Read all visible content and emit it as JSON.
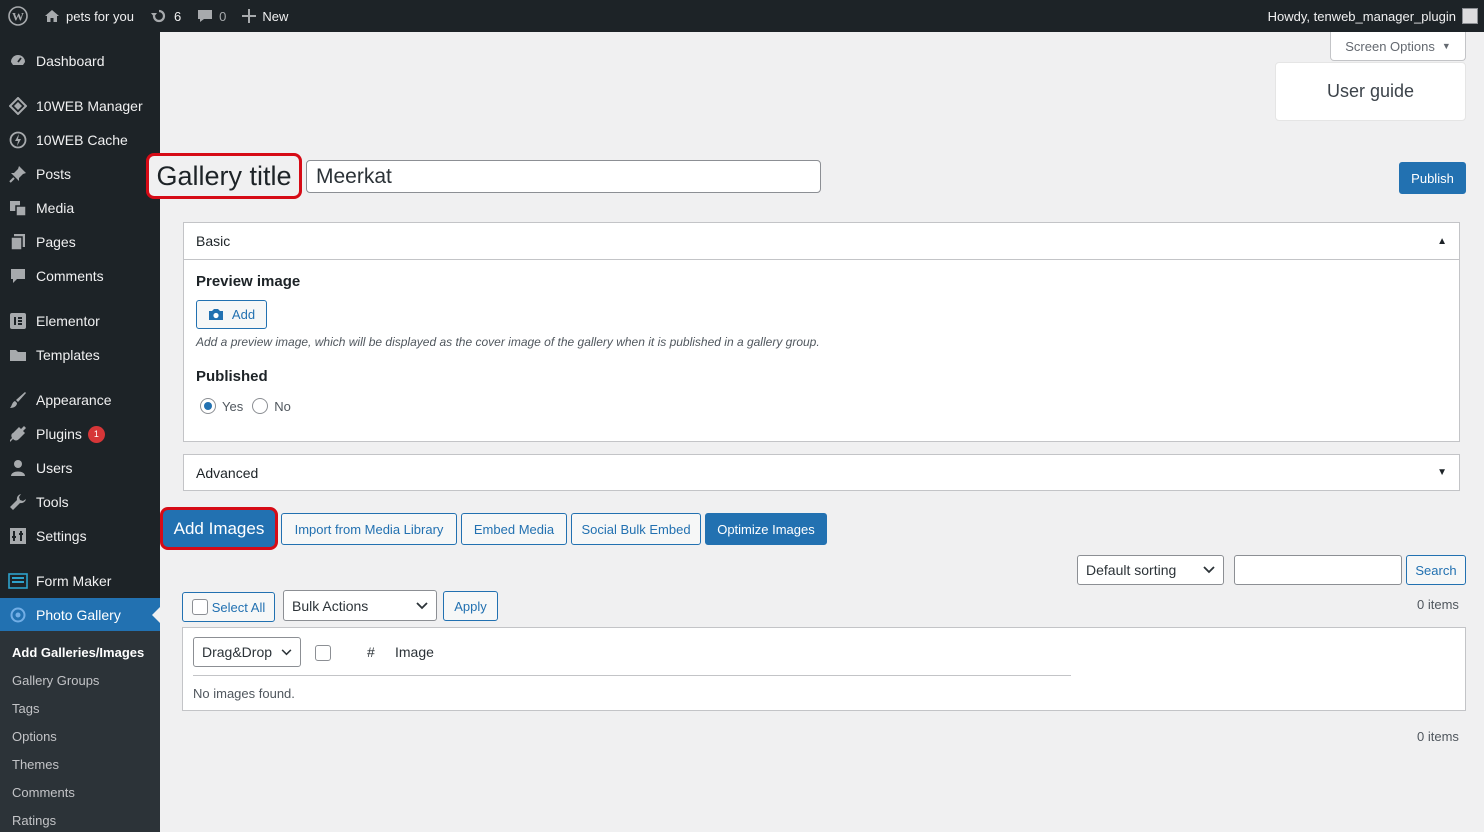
{
  "adminbar": {
    "site_name": "pets for you",
    "updates_count": "6",
    "comments_count": "0",
    "new_label": "New",
    "howdy": "Howdy, tenweb_manager_plugin"
  },
  "sidebar": {
    "items": [
      {
        "label": "Dashboard",
        "icon": "dashboard-icon"
      },
      {
        "label": "10WEB Manager",
        "icon": "tenweb-manager-icon"
      },
      {
        "label": "10WEB Cache",
        "icon": "tenweb-cache-icon"
      },
      {
        "label": "Posts",
        "icon": "pin-icon"
      },
      {
        "label": "Media",
        "icon": "media-icon"
      },
      {
        "label": "Pages",
        "icon": "pages-icon"
      },
      {
        "label": "Comments",
        "icon": "comment-icon"
      },
      {
        "label": "Elementor",
        "icon": "elementor-icon"
      },
      {
        "label": "Templates",
        "icon": "folder-icon"
      },
      {
        "label": "Appearance",
        "icon": "brush-icon"
      },
      {
        "label": "Plugins",
        "icon": "plug-icon",
        "badge": "1"
      },
      {
        "label": "Users",
        "icon": "users-icon"
      },
      {
        "label": "Tools",
        "icon": "wrench-icon"
      },
      {
        "label": "Settings",
        "icon": "settings-icon"
      },
      {
        "label": "Form Maker",
        "icon": "form-icon"
      },
      {
        "label": "Photo Gallery",
        "icon": "gallery-icon"
      }
    ],
    "submenu": [
      "Add Galleries/Images",
      "Gallery Groups",
      "Tags",
      "Options",
      "Themes",
      "Comments",
      "Ratings"
    ]
  },
  "screen_options": "Screen Options",
  "user_guide": "User guide",
  "gallery": {
    "title_label": "Gallery title",
    "title_value": "Meerkat",
    "publish": "Publish"
  },
  "basic": {
    "header": "Basic",
    "preview_label": "Preview image",
    "add_button": "Add",
    "preview_desc": "Add a preview image, which will be displayed as the cover image of the gallery when it is published in a gallery group.",
    "published_label": "Published",
    "yes": "Yes",
    "no": "No",
    "published_value": "Yes"
  },
  "advanced": {
    "header": "Advanced"
  },
  "toolbar": {
    "add_images": "Add Images",
    "import": "Import from Media Library",
    "embed": "Embed Media",
    "social": "Social Bulk Embed",
    "optimize": "Optimize Images"
  },
  "filters": {
    "sorting": "Default sorting",
    "search_value": "",
    "search_button": "Search",
    "select_all": "Select All",
    "bulk_actions": "Bulk Actions",
    "apply": "Apply",
    "items_top": "0 items",
    "items_bottom": "0 items"
  },
  "table": {
    "order_select": "Drag&Drop",
    "col_hash": "#",
    "col_image": "Image",
    "empty": "No images found."
  },
  "colors": {
    "accent": "#2271b1",
    "sidebar_bg": "#1d2327",
    "highlight": "#d60b16",
    "page_bg": "#f0f0f1"
  }
}
